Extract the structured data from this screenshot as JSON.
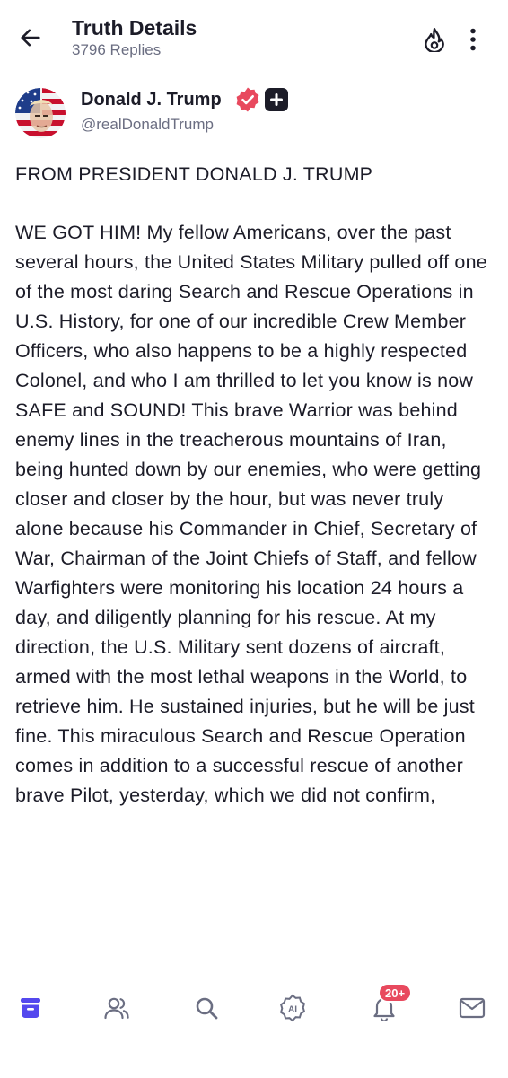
{
  "header": {
    "title": "Truth Details",
    "replies": "3796 Replies",
    "icons": [
      "back-arrow-icon",
      "flame-icon",
      "more-vertical-icon"
    ]
  },
  "author": {
    "name": "Donald J. Trump",
    "handle": "@realDonaldTrump",
    "verified": true,
    "badge_icon": "plus-badge-icon"
  },
  "post": {
    "heading": "FROM PRESIDENT DONALD J. TRUMP",
    "body": "WE GOT HIM! My fellow Americans, over the past several hours, the United States Military pulled off one of the most daring Search and Rescue Operations in U.S. History, for one of our incredible Crew Member Officers, who also happens to be a highly respected Colonel, and who I am thrilled to let you know is now SAFE and SOUND! This brave Warrior was behind enemy lines in the treacherous mountains of Iran, being hunted down by our enemies, who were getting closer and closer by the hour, but was never truly alone because his Commander in Chief, Secretary of War, Chairman of the Joint Chiefs of Staff, and fellow Warfighters were monitoring his location 24 hours a day, and diligently planning for his rescue. At my direction, the U.S. Military sent dozens of aircraft, armed with the most lethal weapons in the World, to retrieve him. He sustained injuries, but he will be just fine. This miraculous Search and Rescue Operation comes in addition to a successful rescue of another brave Pilot, yesterday, which we did not confirm,"
  },
  "tabbar": {
    "tabs": [
      "home-icon",
      "people-icon",
      "search-icon",
      "ai-icon",
      "notifications-icon",
      "messages-icon"
    ],
    "notification_badge": "20+"
  },
  "colors": {
    "accent": "#5448ee",
    "badge": "#e8495e",
    "verified": "#e8495e",
    "text": "#1c1c28",
    "muted": "#6b6e82"
  }
}
